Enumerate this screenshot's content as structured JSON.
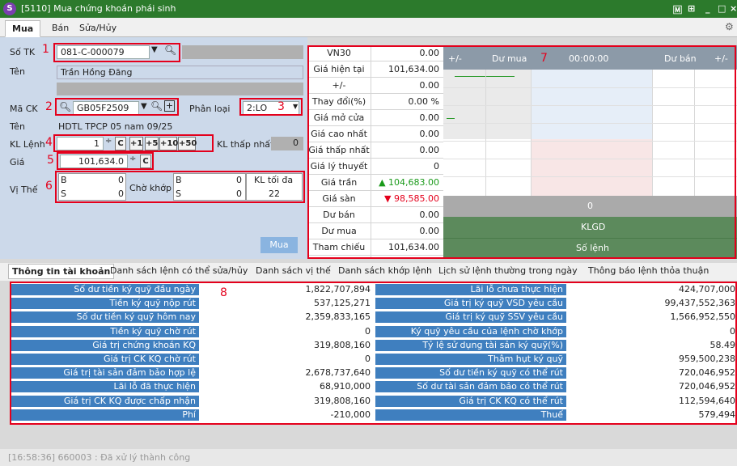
{
  "window": {
    "title": "[5110] Mua chứng khoán phái sinh",
    "controls": [
      "🄼",
      "⊞",
      "_",
      "□",
      "×"
    ]
  },
  "tabs": [
    "Mua",
    "Bán",
    "Sửa/Hủy"
  ],
  "form": {
    "so_tk_label": "Số TK",
    "account": "081-C-000079",
    "ten_label": "Tên",
    "name": "Trần Hồng Đăng",
    "ma_ck_label": "Mã CK",
    "symbol": "GB05F2509",
    "phan_loai_label": "Phân loại",
    "phan_loai": "2:LO",
    "ten2_label": "Tên",
    "symbol_name": "HDTL TPCP 05 nam 09/25",
    "kl_lenh_label": "KL Lệnh",
    "kl_lenh": "1",
    "kl_buttons": [
      "C",
      "+1",
      "+5",
      "+10",
      "+50"
    ],
    "kl_thap_nhat_label": "KL thấp nhất",
    "kl_thap_nhat": "0",
    "gia_label": "Giá",
    "gia": "101,634.0",
    "gia_clear": "C",
    "vi_the_label": "Vị Thế",
    "vi_the_b_label": "B",
    "vi_the_b": "0",
    "vi_the_s_label": "S",
    "vi_the_s": "0",
    "cho_khop_label": "Chờ khớp",
    "cho_khop_b_label": "B",
    "cho_khop_b": "0",
    "cho_khop_s_label": "S",
    "cho_khop_s": "0",
    "kl_toi_da_label": "KL tối đa",
    "kl_toi_da": "22",
    "submit": "Mua"
  },
  "market": [
    {
      "k": "VN30",
      "v": "0.00"
    },
    {
      "k": "Giá hiện tại",
      "v": "101,634.00"
    },
    {
      "k": "+/-",
      "v": "0.00"
    },
    {
      "k": "Thay đổi(%)",
      "v": "0.00 %"
    },
    {
      "k": "Giá mở cửa",
      "v": "0.00"
    },
    {
      "k": "Giá cao nhất",
      "v": "0.00"
    },
    {
      "k": "Giá thấp nhất",
      "v": "0.00"
    },
    {
      "k": "Giá lý thuyết",
      "v": "0"
    },
    {
      "k": "Giá trần",
      "v": "▲ 104,683.00",
      "color": "#1a9a1a"
    },
    {
      "k": "Giá sàn",
      "v": "▼  98,585.00",
      "color": "#e4001c"
    },
    {
      "k": "Dư bán",
      "v": "0.00"
    },
    {
      "k": "Dư mua",
      "v": "0.00"
    },
    {
      "k": "Tham chiếu",
      "v": "101,634.00"
    }
  ],
  "orderbook": {
    "headers": [
      "+/-",
      "Dư mua",
      "00:00:00",
      "Dư bán",
      "+/-"
    ],
    "total": "0",
    "klgd": "KLGD",
    "so_lenh": "Số lệnh"
  },
  "bottom_tabs": [
    "Thông tin tài khoản",
    "Danh sách lệnh có thể sửa/hủy",
    "Danh sách vị thế",
    "Danh sách khớp lệnh",
    "Lịch sử lệnh thường trong ngày",
    "Thông báo lệnh thỏa thuận"
  ],
  "account": [
    {
      "l1": "Số dư tiền ký quỹ đầu ngày",
      "v1": "1,822,707,894",
      "l2": "Lãi lỗ chưa thực hiện",
      "v2": "424,707,000"
    },
    {
      "l1": "Tiền ký quỹ nộp rút",
      "v1": "537,125,271",
      "l2": "Giá trị ký quỹ VSD yêu cầu",
      "v2": "99,437,552,363"
    },
    {
      "l1": "Số dư tiền ký quỹ hôm nay",
      "v1": "2,359,833,165",
      "l2": "Giá trị ký quỹ SSV yêu cầu",
      "v2": "1,566,952,550"
    },
    {
      "l1": "Tiền ký quỹ chờ rút",
      "v1": "0",
      "l2": "Ký quỹ yêu cầu của lệnh chờ khớp",
      "v2": "0"
    },
    {
      "l1": "Giá trị chứng khoán KQ",
      "v1": "319,808,160",
      "l2": "Tỷ lệ sử dụng tài sản ký quỹ(%)",
      "v2": "58.49"
    },
    {
      "l1": "Giá trị CK KQ chờ rút",
      "v1": "0",
      "l2": "Thâm hụt ký quỹ",
      "v2": "959,500,238"
    },
    {
      "l1": "Giá trị tài sản đảm bảo hợp lệ",
      "v1": "2,678,737,640",
      "l2": "Số dư tiền ký quỹ có thể rút",
      "v2": "720,046,952"
    },
    {
      "l1": "Lãi lỗ đã thực hiện",
      "v1": "68,910,000",
      "l2": "Số dư tài sản đảm bảo có thể rút",
      "v2": "720,046,952"
    },
    {
      "l1": "Giá trị CK KQ được chấp nhận",
      "v1": "319,808,160",
      "l2": "Giá trị CK KQ có thể rút",
      "v2": "112,594,640"
    },
    {
      "l1": "Phí",
      "v1": "-210,000",
      "l2": "Thuế",
      "v2": "579,494"
    }
  ],
  "markers": [
    "1",
    "2",
    "3",
    "4",
    "5",
    "6",
    "7",
    "8"
  ],
  "status": "[16:58:36] 660003 : Đã xử lý thành công",
  "colors": {
    "title_bg": "#2c7a2c",
    "panel_bg": "#ccd9ea",
    "label_bg": "#3f7fbf",
    "red_marker": "#e4001c",
    "ceiling": "#1a9a1a",
    "floor": "#e4001c"
  }
}
